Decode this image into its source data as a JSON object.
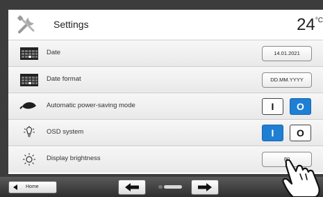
{
  "header": {
    "title": "Settings",
    "temperature": "24",
    "temperature_unit": "°C",
    "icon": "tools-icon"
  },
  "rows": [
    {
      "label": "Date",
      "icon": "calendar-icon",
      "control": "value",
      "value": "14.01.2021"
    },
    {
      "label": "Date format",
      "icon": "calendar-icon",
      "control": "value",
      "value": "DD.MM.YYYY"
    },
    {
      "label": "Automatic power-saving mode",
      "icon": "leaf-icon",
      "control": "toggle",
      "on_label": "I",
      "off_label": "O",
      "selected": "off"
    },
    {
      "label": "OSD system",
      "icon": "lightbulb-icon",
      "control": "toggle",
      "on_label": "I",
      "off_label": "O",
      "selected": "on"
    },
    {
      "label": "Display brightness",
      "icon": "sun-icon",
      "control": "value",
      "value": "80"
    }
  ],
  "bottombar": {
    "home_label": "Home",
    "prev_icon": "arrow-left-icon",
    "next_icon": "arrow-right-icon",
    "pages": 2,
    "current_page": 2
  },
  "colors": {
    "accent": "#1f7fd3",
    "background": "#3c3c3c"
  }
}
